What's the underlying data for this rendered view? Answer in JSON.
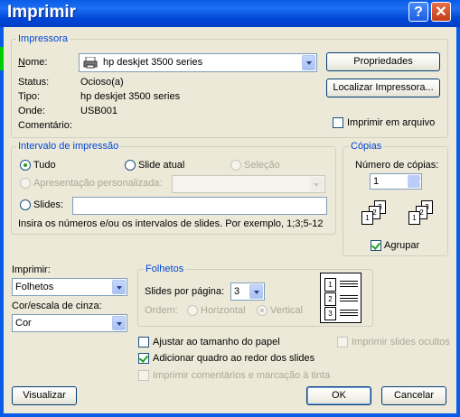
{
  "window": {
    "title": "Imprimir",
    "help_glyph": "?",
    "close_glyph": "✕"
  },
  "printer": {
    "legend": "Impressora",
    "name_label": "Nome:",
    "name_value": "hp deskjet 3500 series",
    "status_label": "Status:",
    "status_value": "Ocioso(a)",
    "type_label": "Tipo:",
    "type_value": "hp deskjet 3500 series",
    "where_label": "Onde:",
    "where_value": "USB001",
    "comment_label": "Comentário:",
    "properties_button": "Propriedades",
    "find_printer_button": "Localizar Impressora...",
    "print_to_file_label": "Imprimir em arquivo"
  },
  "range": {
    "legend": "Intervalo de impressão",
    "all_label": "Tudo",
    "current_slide_label": "Slide atual",
    "selection_label": "Seleção",
    "custom_show_label": "Apresentação personalizada:",
    "slides_label": "Slides:",
    "slides_value": "",
    "hint": "Insira os números e/ou os intervalos de slides. Por exemplo, 1;3;5-12"
  },
  "copies": {
    "legend": "Cópias",
    "count_label": "Número de cópias:",
    "count_value": "1",
    "collate_label": "Agrupar",
    "collate_checked": true
  },
  "print_what": {
    "label": "Imprimir:",
    "value": "Folhetos",
    "color_label": "Cor/escala de cinza:",
    "color_value": "Cor"
  },
  "handouts": {
    "legend": "Folhetos",
    "slides_per_page_label": "Slides por página:",
    "slides_per_page_value": "3",
    "order_label": "Ordem:",
    "horizontal_label": "Horizontal",
    "vertical_label": "Vertical",
    "preview_numbers": [
      "1",
      "2",
      "3"
    ]
  },
  "options": {
    "scale_to_fit": "Ajustar ao tamanho do papel",
    "frame_slides": "Adicionar quadro ao redor dos slides",
    "frame_slides_checked": true,
    "print_comments": "Imprimir comentários e marcação à tinta",
    "print_hidden": "Imprimir slides ocultos"
  },
  "footer": {
    "preview_button": "Visualizar",
    "ok_button": "OK",
    "cancel_button": "Cancelar"
  }
}
